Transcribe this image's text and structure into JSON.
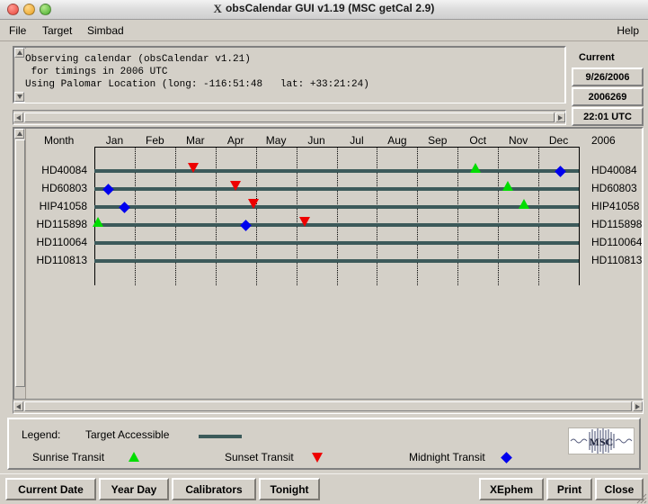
{
  "window": {
    "title": "obsCalendar GUI v1.19 (MSC getCal 2.9)",
    "x_icon": "X"
  },
  "menubar": {
    "items": [
      {
        "label": "File"
      },
      {
        "label": "Target"
      },
      {
        "label": "Simbad"
      }
    ],
    "help": "Help"
  },
  "info_text": {
    "line1": "Observing calendar (obsCalendar v1.21)",
    "line2": " for timings in 2006 UTC",
    "line3": "Using Palomar Location (long: -116:51:48   lat: +33:21:24)"
  },
  "current_panel": {
    "header": "Current",
    "date": "9/26/2006",
    "yearday": "2006269",
    "time": "22:01 UTC"
  },
  "chart_data": {
    "type": "bar",
    "title": "",
    "month_header": "Month",
    "year_label": "2006",
    "categories": [
      "Jan",
      "Feb",
      "Mar",
      "Apr",
      "May",
      "Jun",
      "Jul",
      "Aug",
      "Sep",
      "Oct",
      "Nov",
      "Dec"
    ],
    "xlabel": "",
    "ylabel": "",
    "grid": true,
    "legend_position": "bottom",
    "rows": [
      {
        "name": "HD40084",
        "segments": [
          {
            "start_month": 0.0,
            "end_month": 12.0
          }
        ],
        "markers": [
          {
            "type": "sunset-transit",
            "month": 2.45
          },
          {
            "type": "sunrise-transit",
            "month": 9.45
          },
          {
            "type": "midnight-transit",
            "month": 11.55
          }
        ]
      },
      {
        "name": "HD60803",
        "segments": [
          {
            "start_month": 0.0,
            "end_month": 12.0
          }
        ],
        "markers": [
          {
            "type": "midnight-transit",
            "month": 0.35
          },
          {
            "type": "sunset-transit",
            "month": 3.5
          },
          {
            "type": "sunrise-transit",
            "month": 10.25
          }
        ]
      },
      {
        "name": "HIP41058",
        "segments": [
          {
            "start_month": 0.0,
            "end_month": 12.0
          }
        ],
        "markers": [
          {
            "type": "midnight-transit",
            "month": 0.75
          },
          {
            "type": "sunset-transit",
            "month": 3.95
          },
          {
            "type": "sunrise-transit",
            "month": 10.65
          }
        ]
      },
      {
        "name": "HD115898",
        "segments": [
          {
            "start_month": 0.0,
            "end_month": 12.0
          }
        ],
        "markers": [
          {
            "type": "sunrise-transit",
            "month": 0.1
          },
          {
            "type": "midnight-transit",
            "month": 3.75
          },
          {
            "type": "sunset-transit",
            "month": 5.2
          }
        ]
      },
      {
        "name": "HD110064",
        "segments": [
          {
            "start_month": 0.0,
            "end_month": 12.0
          }
        ],
        "markers": []
      },
      {
        "name": "HD110813",
        "segments": [
          {
            "start_month": 0.0,
            "end_month": 12.0
          }
        ],
        "markers": []
      }
    ]
  },
  "legend": {
    "title": "Legend:",
    "target_accessible": "Target Accessible",
    "sunrise_transit": "Sunrise Transit",
    "sunset_transit": "Sunset Transit",
    "midnight_transit": "Midnight Transit",
    "logo_text": "MSC"
  },
  "buttons": {
    "left": [
      {
        "label": "Current Date"
      },
      {
        "label": "Year Day"
      },
      {
        "label": "Calibrators"
      },
      {
        "label": "Tonight"
      }
    ],
    "right": [
      {
        "label": "XEphem"
      },
      {
        "label": "Print"
      },
      {
        "label": "Close"
      }
    ]
  },
  "colors": {
    "track": "#3c5a5a",
    "sunrise": "#00dd00",
    "sunset": "#ee0000",
    "midnight": "#0000ee",
    "face": "#d4d0c8"
  }
}
